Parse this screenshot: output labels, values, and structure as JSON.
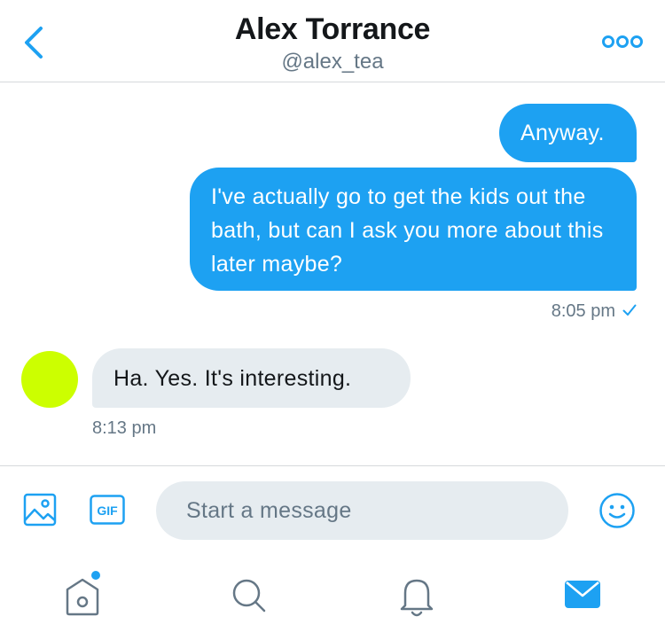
{
  "header": {
    "title": "Alex Torrance",
    "handle": "@alex_tea",
    "back_icon": "chevron-left-icon",
    "more_icon": "more-dots-icon"
  },
  "conversation": {
    "messages": [
      {
        "direction": "outgoing",
        "text": "Anyway."
      },
      {
        "direction": "outgoing",
        "text": "I've actually go to get the kids out the bath, but can I ask you more about this later maybe?"
      },
      {
        "direction": "incoming",
        "text": "Ha. Yes. It's interesting."
      }
    ],
    "outgoing_time": "8:05 pm",
    "outgoing_status": "✓",
    "incoming_time": "8:13 pm",
    "avatar_color": "#ccff00"
  },
  "composer": {
    "placeholder": "Start a message",
    "image_icon": "image-icon",
    "gif_label": "GIF",
    "emoji_icon": "emoji-icon"
  },
  "tabbar": {
    "items": [
      {
        "name": "home",
        "icon": "home-icon",
        "has_notification_dot": true
      },
      {
        "name": "search",
        "icon": "search-icon"
      },
      {
        "name": "notifications",
        "icon": "bell-icon"
      },
      {
        "name": "messages",
        "icon": "envelope-icon",
        "active": true
      }
    ]
  },
  "colors": {
    "accent": "#1da1f2",
    "incoming_bubble": "#e6ecf0",
    "secondary_text": "#657786",
    "divider": "#d6d9dc"
  }
}
